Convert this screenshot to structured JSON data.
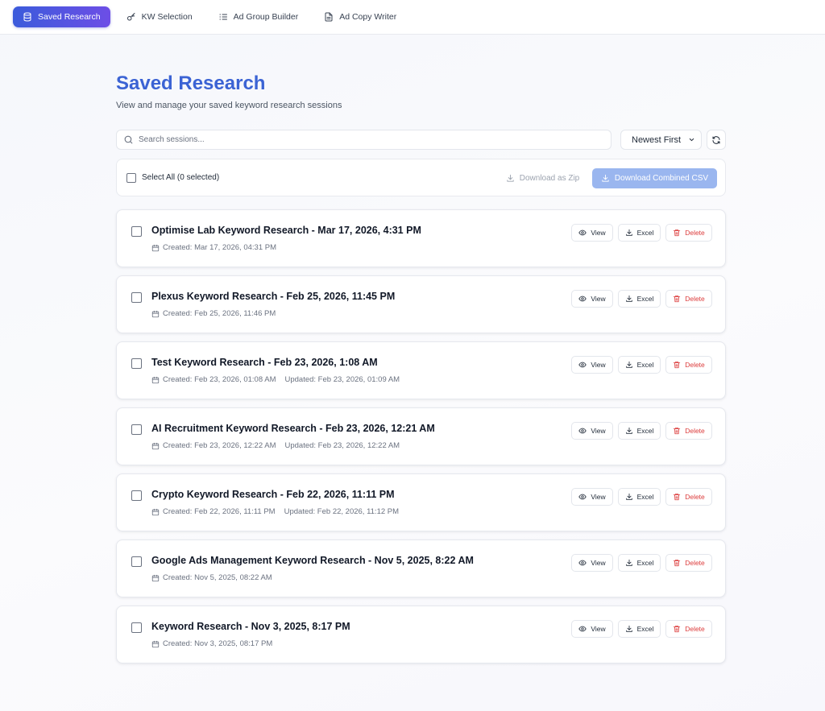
{
  "nav": {
    "tabs": [
      {
        "label": "Saved Research",
        "icon": "database-icon",
        "active": true
      },
      {
        "label": "KW Selection",
        "icon": "key-icon",
        "active": false
      },
      {
        "label": "Ad Group Builder",
        "icon": "list-icon",
        "active": false
      },
      {
        "label": "Ad Copy Writer",
        "icon": "document-icon",
        "active": false
      }
    ]
  },
  "page": {
    "title": "Saved Research",
    "subtitle": "View and manage your saved keyword research sessions"
  },
  "toolbar": {
    "search_placeholder": "Search sessions...",
    "sort_value": "Newest First"
  },
  "selection": {
    "label": "Select All (0 selected)",
    "zip_label": "Download as Zip",
    "csv_label": "Download Combined CSV"
  },
  "actions": {
    "view": "View",
    "excel": "Excel",
    "delete": "Delete"
  },
  "sessions": [
    {
      "title": "Optimise Lab Keyword Research - Mar 17, 2026, 4:31 PM",
      "created": "Created: Mar 17, 2026, 04:31 PM",
      "updated": ""
    },
    {
      "title": "Plexus Keyword Research - Feb 25, 2026, 11:45 PM",
      "created": "Created: Feb 25, 2026, 11:46 PM",
      "updated": ""
    },
    {
      "title": "Test Keyword Research - Feb 23, 2026, 1:08 AM",
      "created": "Created: Feb 23, 2026, 01:08 AM",
      "updated": "Updated: Feb 23, 2026, 01:09 AM"
    },
    {
      "title": "AI Recruitment Keyword Research - Feb 23, 2026, 12:21 AM",
      "created": "Created: Feb 23, 2026, 12:22 AM",
      "updated": "Updated: Feb 23, 2026, 12:22 AM"
    },
    {
      "title": "Crypto Keyword Research - Feb 22, 2026, 11:11 PM",
      "created": "Created: Feb 22, 2026, 11:11 PM",
      "updated": "Updated: Feb 22, 2026, 11:12 PM"
    },
    {
      "title": "Google Ads Management Keyword Research - Nov 5, 2025, 8:22 AM",
      "created": "Created: Nov 5, 2025, 08:22 AM",
      "updated": ""
    },
    {
      "title": "Keyword Research - Nov 3, 2025, 8:17 PM",
      "created": "Created: Nov 3, 2025, 08:17 PM",
      "updated": ""
    }
  ]
}
